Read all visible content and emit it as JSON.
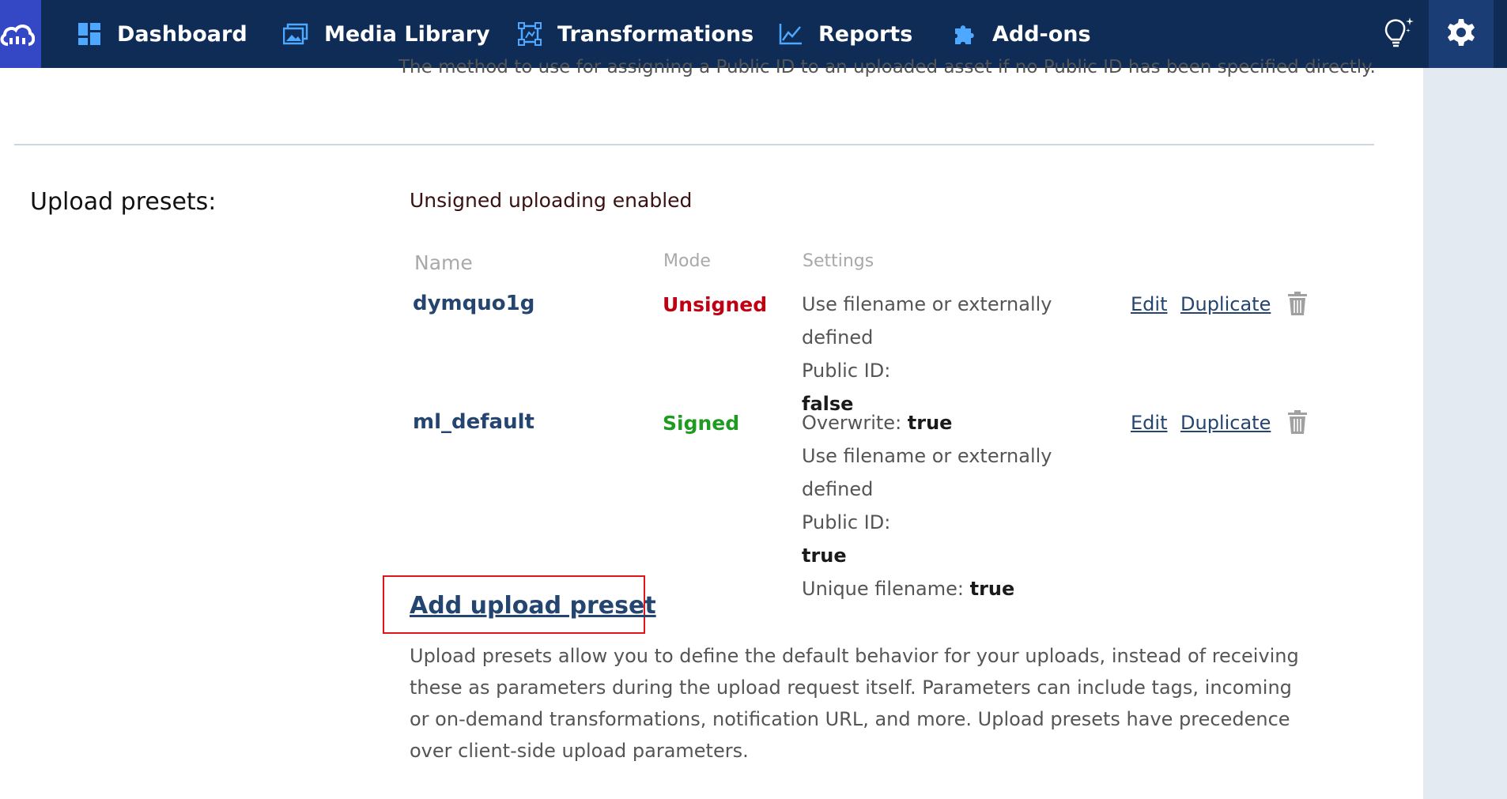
{
  "nav": {
    "items": [
      {
        "label": "Dashboard",
        "icon": "dashboard-icon"
      },
      {
        "label": "Media Library",
        "icon": "media-library-icon"
      },
      {
        "label": "Transformations",
        "icon": "transformations-icon"
      },
      {
        "label": "Reports",
        "icon": "reports-icon"
      },
      {
        "label": "Add-ons",
        "icon": "puzzle-icon"
      }
    ],
    "colors": {
      "bar": "#0e2c55",
      "logo": "#3448c5",
      "active_settings": "#1b3d76"
    }
  },
  "cutoff_description": "The method to use for assigning a Public ID to an uploaded asset if no Public ID has been specified directly.",
  "upload_presets": {
    "label": "Upload presets:",
    "status": "Unsigned uploading enabled",
    "headers": {
      "name": "Name",
      "mode": "Mode",
      "settings": "Settings"
    },
    "rows": [
      {
        "name": "dymquo1g",
        "mode": "Unsigned",
        "settings": [
          {
            "text": "Use filename or externally defined",
            "value": ""
          },
          {
            "text": "Public ID:",
            "value": ""
          },
          {
            "text": "",
            "value": "false"
          }
        ],
        "edit": "Edit",
        "duplicate": "Duplicate"
      },
      {
        "name": "ml_default",
        "mode": "Signed",
        "settings": [
          {
            "text": "Overwrite: ",
            "value": "true"
          },
          {
            "text": "Use filename or externally defined",
            "value": ""
          },
          {
            "text": "Public ID:",
            "value": ""
          },
          {
            "text": "",
            "value": "true"
          },
          {
            "text": "Unique filename: ",
            "value": "true"
          }
        ],
        "edit": "Edit",
        "duplicate": "Duplicate"
      }
    ],
    "add_link": "Add upload preset",
    "help": "Upload presets allow you to define the default behavior for your uploads, instead of receiving these as parameters during the upload request itself. Parameters can include tags, incoming or on-demand transformations, notification URL, and more. Upload presets have precedence over client-side upload parameters."
  }
}
